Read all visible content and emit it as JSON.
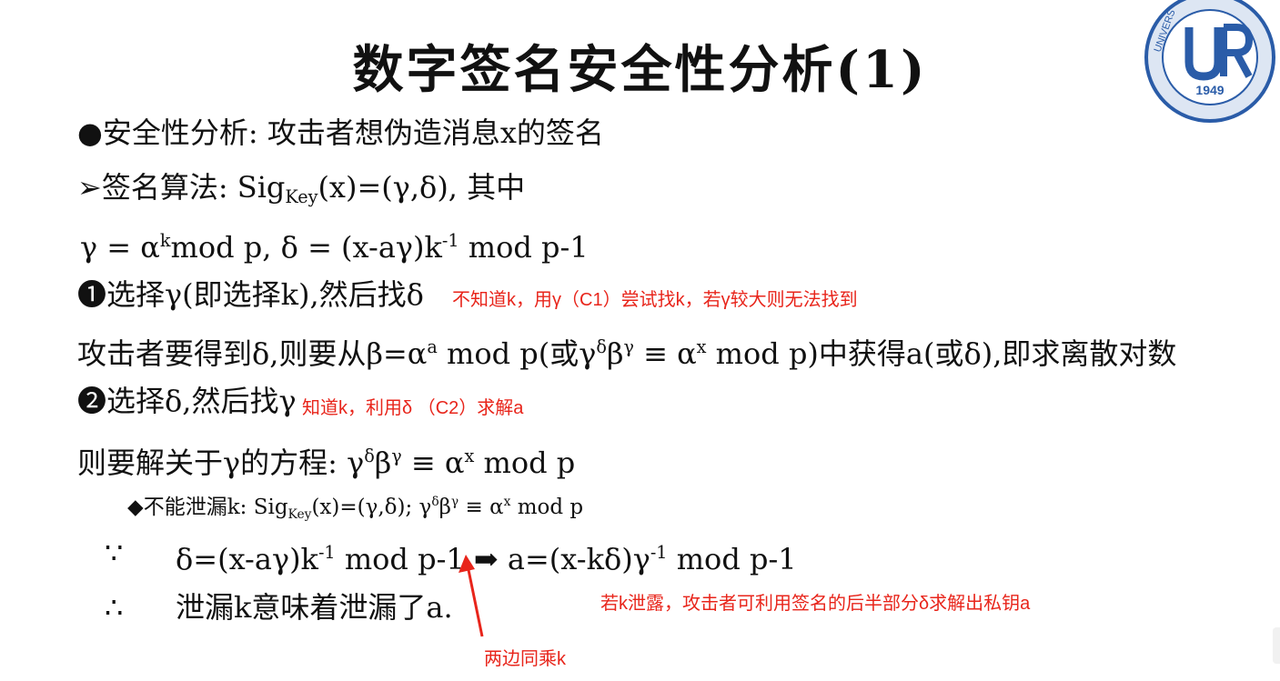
{
  "title": "数字签名安全性分析(1)",
  "logo": {
    "year": "1949",
    "lettering": "UNIVERSITY 国际关系学院"
  },
  "lines": {
    "l1_bullet": "●",
    "l1_text": "安全性分析: 攻击者想伪造消息x的签名",
    "l2_bullet": "➢",
    "l2_a": "签名算法: Sig",
    "l2_sub": "Key",
    "l2_b": "(x)=(γ,δ), 其中",
    "l3_a": "γ = α",
    "l3_sup1": "k",
    "l3_b": "mod p,  δ = (x-aγ)k",
    "l3_sup2": "-1",
    "l3_c": " mod p-1",
    "l4_bullet": "❶",
    "l4_text": "选择γ(即选择k),然后找δ",
    "l5_a": "攻击者要得到δ,则要从β=α",
    "l5_sup1": "a",
    "l5_b": " mod p(或γ",
    "l5_sup2": "δ",
    "l5_c": "β",
    "l5_sup3": "γ",
    "l5_d": " ≡ α",
    "l5_sup4": "x",
    "l5_e": " mod p)中获得a(或δ),即求离散对数",
    "l6_bullet": "❷",
    "l6_text": "选择δ,然后找γ",
    "l7_a": "则要解关于γ的方程: γ",
    "l7_sup1": "δ",
    "l7_b": "β",
    "l7_sup2": "γ",
    "l7_c": " ≡ α",
    "l7_sup3": "x",
    "l7_d": " mod p",
    "l8_bullet": "◆",
    "l8_a": "不能泄漏k: Sig",
    "l8_sub": "Key",
    "l8_b": "(x)=(γ,δ);  γ",
    "l8_sup1": "δ",
    "l8_c": "β",
    "l8_sup2": "γ",
    "l8_d": " ≡ α",
    "l8_sup3": "x",
    "l8_e": " mod p",
    "l9_symbol": "∵",
    "l9_a": "δ=(x-aγ)k",
    "l9_sup1": "-1",
    "l9_b": " mod p-1",
    "l9_arrow": "➡",
    "l9_c": " a=(x-kδ)γ",
    "l9_sup2": "-1",
    "l9_d": " mod p-1",
    "l10_symbol": "∴",
    "l10_text": "泄漏k意味着泄漏了a."
  },
  "notes": {
    "note1": "不知道k，用γ（C1）尝试找k，若γ较大则无法找到",
    "note2": "知道k，利用δ （C2）求解a",
    "note3": "若k泄露，攻击者可利用签名的后半部分δ求解出私钥a",
    "note4": "两边同乘k"
  },
  "colors": {
    "annotation": "#e8251b",
    "logo_blue": "#2a5ca8",
    "text": "#111111"
  }
}
